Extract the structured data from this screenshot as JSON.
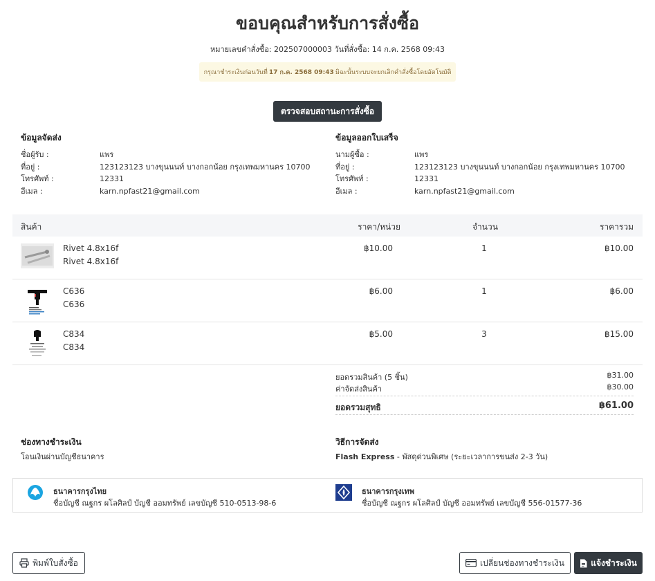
{
  "header": {
    "title": "ขอบคุณสำหรับการสั่งซื้อ",
    "order_meta": "หมายเลขคำสั่งซื้อ: 202507000003 วันที่สั่งซื้อ: 14 ก.ค. 2568 09:43",
    "warning_prefix": "กรุณาชำระเงินก่อนวันที่",
    "warning_deadline": "17 ก.ค. 2568 09:43",
    "warning_suffix": "มิฉะนั้นระบบจะยกเลิกคำสั่งซื้อโดยอัตโนมัติ",
    "status_button": "ตรวจสอบสถานะการสั่งซื้อ"
  },
  "shipping": {
    "title": "ข้อมูลจัดส่ง",
    "rows": [
      {
        "label": "ชื่อผู้รับ :",
        "value": "แพร"
      },
      {
        "label": "ที่อยู่ :",
        "value": "123123123 บางขุนนนท์ บางกอกน้อย กรุงเทพมหานคร 10700"
      },
      {
        "label": "โทรศัพท์ :",
        "value": "12331"
      },
      {
        "label": "อีเมล :",
        "value": "karn.npfast21@gmail.com"
      }
    ]
  },
  "billing": {
    "title": "ข้อมูลออกใบเสร็จ",
    "rows": [
      {
        "label": "นามผู้ซื้อ :",
        "value": "แพร"
      },
      {
        "label": "ที่อยู่ :",
        "value": "123123123 บางขุนนนท์ บางกอกน้อย กรุงเทพมหานคร 10700"
      },
      {
        "label": "โทรศัพท์ :",
        "value": "12331"
      },
      {
        "label": "อีเมล :",
        "value": "karn.npfast21@gmail.com"
      }
    ]
  },
  "table": {
    "headers": {
      "product": "สินค้า",
      "unit_price": "ราคา/หน่วย",
      "qty": "จำนวน",
      "total": "ราคารวม"
    },
    "items": [
      {
        "name": "Rivet 4.8x16f",
        "subname": "Rivet 4.8x16f",
        "price": "฿10.00",
        "qty": "1",
        "total": "฿10.00"
      },
      {
        "name": "C636",
        "subname": "C636",
        "price": "฿6.00",
        "qty": "1",
        "total": "฿6.00"
      },
      {
        "name": "C834",
        "subname": "C834",
        "price": "฿5.00",
        "qty": "3",
        "total": "฿15.00"
      }
    ]
  },
  "summary": {
    "subtotal_label": "ยอดรวมสินค้า (5 ชิ้น)",
    "subtotal_value": "฿31.00",
    "shipping_label": "ค่าจัดส่งสินค้า",
    "shipping_value": "฿30.00",
    "grand_label": "ยอดรวมสุทธิ",
    "grand_value": "฿61.00"
  },
  "payment": {
    "title": "ช่องทางชำระเงิน",
    "method": "โอนเงินผ่านบัญชีธนาคาร"
  },
  "delivery": {
    "title": "วิธีการจัดส่ง",
    "carrier": "Flash Express",
    "detail": " - พัสดุด่วนพิเศษ (ระยะเวลาการขนส่ง 2-3 วัน)"
  },
  "banks": [
    {
      "name": "ธนาคารกรุงไทย",
      "account": "ชื่อบัญชี ณฐกร ผโลศิลป์ บัญชี ออมทรัพย์ เลขบัญชี 510-0513-98-6",
      "color": "#1ba5e1"
    },
    {
      "name": "ธนาคารกรุงเทพ",
      "account": "ชื่อบัญชี ณฐกร ผโลศิลป์ บัญชี ออมทรัพย์ เลขบัญชี 556-01577-36",
      "color": "#1e3d8f"
    }
  ],
  "footer": {
    "print_button": "พิมพ์ใบสั่งซื้อ",
    "change_payment_button": "เปลี่ยนช่องทางชำระเงิน",
    "notify_payment_button": "แจ้งชำระเงิน"
  }
}
